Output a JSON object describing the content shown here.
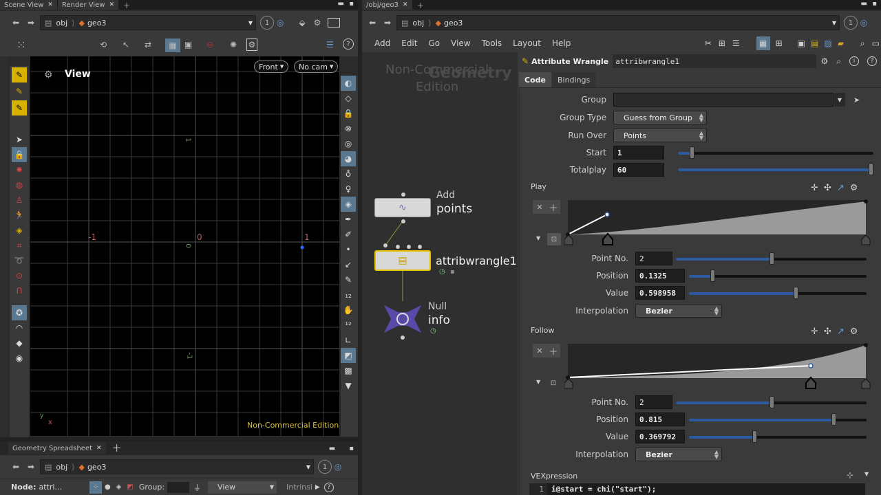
{
  "left": {
    "tabs": [
      "Scene View",
      "Render View"
    ],
    "path": [
      "obj",
      "geo3"
    ],
    "view_label": "View",
    "front_btn": "Front",
    "cam_btn": "No cam",
    "axis_labels": [
      "-1",
      "0",
      "1",
      "1",
      "0",
      "-1"
    ],
    "nce": "Non-Commercial Edition",
    "corner_axes": "y  x"
  },
  "bottom_left": {
    "tabs": [
      "Geometry Spreadsheet"
    ],
    "path": [
      "obj",
      "geo3"
    ],
    "node_label": "Node:",
    "node_value": "attri...",
    "group_label": "Group:",
    "view_drop": "View",
    "intrinsic": "Intrinsi"
  },
  "right": {
    "tab": "/obj/geo3",
    "path": [
      "obj",
      "geo3"
    ],
    "menu": [
      "Add",
      "Edit",
      "Go",
      "View",
      "Tools",
      "Layout",
      "Help"
    ],
    "counter": "1"
  },
  "network": {
    "watermark1": "Non-Commercial",
    "watermark2": "Edition",
    "context": "Geometry",
    "nodes": [
      {
        "type": "Add",
        "name": "points"
      },
      {
        "type": "",
        "name": "attribwrangle1"
      },
      {
        "type": "Null",
        "name": "info"
      }
    ]
  },
  "params": {
    "node_type": "Attribute Wrangle",
    "node_name": "attribwrangle1",
    "tabs": [
      "Code",
      "Bindings"
    ],
    "group_label": "Group",
    "group_value": "",
    "group_type_label": "Group Type",
    "group_type_value": "Guess from Group",
    "run_over_label": "Run Over",
    "run_over_value": "Points",
    "start_label": "Start",
    "start_value": "1",
    "start_fraction": 0.07,
    "totalplay_label": "Totalplay",
    "totalplay_value": "60",
    "totalplay_fraction": 1.0,
    "play": {
      "label": "Play",
      "point_no_label": "Point No.",
      "point_no": "2",
      "point_no_fraction": 0.5,
      "position_label": "Position",
      "position": "0.1325",
      "value_label": "Value",
      "value": "0.598958",
      "interp_label": "Interpolation",
      "interp": "Bezier"
    },
    "follow": {
      "label": "Follow",
      "point_no_label": "Point No.",
      "point_no": "2",
      "point_no_fraction": 0.5,
      "position_label": "Position",
      "position": "0.815",
      "value_label": "Value",
      "value": "0.369792",
      "interp_label": "Interpolation",
      "interp": "Bezier"
    },
    "vex_label": "VEXpression",
    "code_line_no": "1",
    "code_line": "i@start = chi(\"start\");"
  },
  "colors": {
    "accent_yellow": "#e8c400",
    "slider_blue": "#2d5aa0",
    "node_null": "#5a4aa8"
  }
}
